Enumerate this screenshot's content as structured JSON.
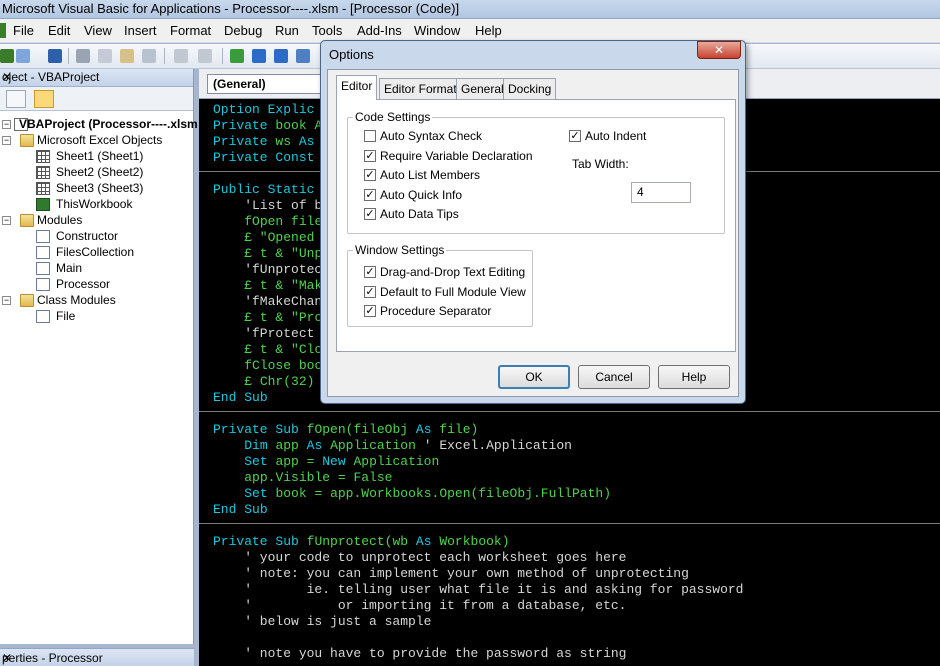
{
  "window": {
    "title": "Microsoft Visual Basic for Applications - Processor----.xlsm - [Processor (Code)]"
  },
  "menu": [
    "File",
    "Edit",
    "View",
    "Insert",
    "Format",
    "Debug",
    "Run",
    "Tools",
    "Add-Ins",
    "Window",
    "Help"
  ],
  "project_panel": {
    "title": "oject - VBAProject",
    "close": "✕",
    "tree": {
      "root": "VBAProject (Processor----.xlsm",
      "excel_objects": "Microsoft Excel Objects",
      "sheets": [
        "Sheet1 (Sheet1)",
        "Sheet2 (Sheet2)",
        "Sheet3 (Sheet3)",
        "ThisWorkbook"
      ],
      "modules_folder": "Modules",
      "modules": [
        "Constructor",
        "FilesCollection",
        "Main",
        "Processor"
      ],
      "class_folder": "Class Modules",
      "classes": [
        "File"
      ]
    }
  },
  "properties_panel": {
    "title": "perties - Processor",
    "close": "✕"
  },
  "code": {
    "object_combo": "(General)",
    "lines": [
      "Option Explic",
      "Private book A",
      "Private ws As",
      "Private Const",
      "",
      "Public Static",
      "    'List of b",
      "    fOpen file",
      "    £ \"Opened",
      "    £ t & \"Unp",
      "    'fUnprotec",
      "    £ t & \"Mak",
      "    'fMakeChan",
      "    £ t & \"Pro",
      "    'fProtect",
      "    £ t & \"Clo",
      "    fClose boo",
      "    £ Chr(32)",
      "End Sub",
      "",
      "Private Sub fOpen(fileObj As file)",
      "    Dim app As Application ' Excel.Application",
      "    Set app = New Application",
      "    app.Visible = False",
      "    Set book = app.Workbooks.Open(fileObj.FullPath)",
      "End Sub",
      "",
      "Private Sub fUnprotect(wb As Workbook)",
      "    ' your code to unprotect each worksheet goes here",
      "    ' note: you can implement your own method of unprotecting",
      "    '       ie. telling user what file it is and asking for password",
      "    '           or importing it from a database, etc.",
      "    ' below is just a sample",
      "",
      "    ' note you have to provide the password as string"
    ]
  },
  "dialog": {
    "title": "Options",
    "close": "✕",
    "tabs": [
      "Editor",
      "Editor Format",
      "General",
      "Docking"
    ],
    "code_settings": {
      "label": "Code Settings",
      "items": [
        {
          "label": "Auto Syntax Check",
          "checked": false
        },
        {
          "label": "Require Variable Declaration",
          "checked": true
        },
        {
          "label": "Auto List Members",
          "checked": true
        },
        {
          "label": "Auto Quick Info",
          "checked": true
        },
        {
          "label": "Auto Data Tips",
          "checked": true
        }
      ],
      "auto_indent": {
        "label": "Auto Indent",
        "checked": true
      },
      "tab_width_label": "Tab Width:",
      "tab_width_value": "4"
    },
    "window_settings": {
      "label": "Window Settings",
      "items": [
        {
          "label": "Drag-and-Drop Text Editing",
          "checked": true
        },
        {
          "label": "Default to Full Module View",
          "checked": true
        },
        {
          "label": "Procedure Separator",
          "checked": true
        }
      ]
    },
    "buttons": {
      "ok": "OK",
      "cancel": "Cancel",
      "help": "Help"
    }
  }
}
